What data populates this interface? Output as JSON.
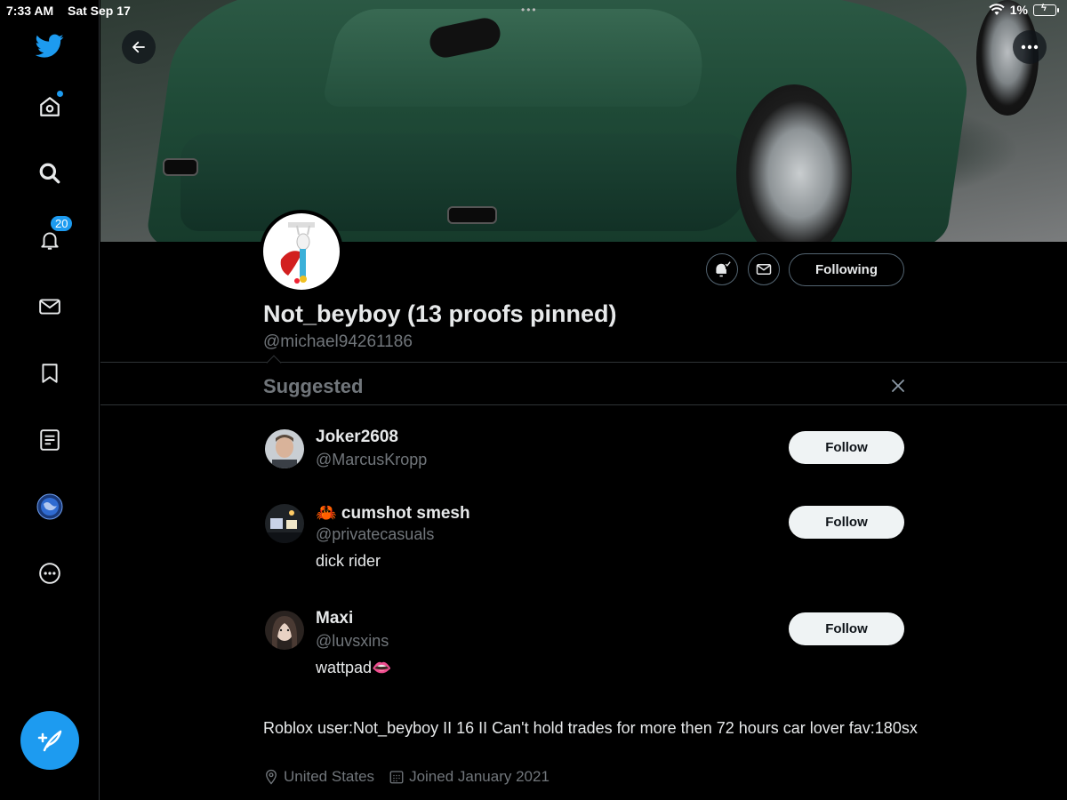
{
  "status_bar": {
    "time": "7:33 AM",
    "date": "Sat Sep 17",
    "battery": "1%"
  },
  "sidebar": {
    "items": [
      {
        "name": "twitter-logo"
      },
      {
        "name": "home"
      },
      {
        "name": "explore"
      },
      {
        "name": "notifications",
        "badge": "20"
      },
      {
        "name": "messages"
      },
      {
        "name": "bookmarks"
      },
      {
        "name": "lists"
      },
      {
        "name": "profile"
      },
      {
        "name": "more"
      }
    ],
    "compose_label": "Tweet"
  },
  "profile": {
    "display_name": "Not_beyboy (13 proofs pinned)",
    "handle": "@michael94261186",
    "following_label": "Following",
    "bio": "Roblox user:Not_beyboy II 16 II Can't hold trades for more then 72 hours car lover fav:180sx",
    "location": "United States",
    "joined": "Joined January 2021"
  },
  "suggested": {
    "title": "Suggested",
    "accounts": [
      {
        "name": "Joker2608",
        "handle": "@MarcusKropp",
        "bio": "",
        "follow_label": "Follow"
      },
      {
        "name": "🦀 cumshot smesh",
        "handle": "@privatecasuals",
        "bio": "dick rider",
        "follow_label": "Follow"
      },
      {
        "name": "Maxi",
        "handle": "@luvsxins",
        "bio": "wattpad👄",
        "follow_label": "Follow"
      }
    ]
  },
  "colors": {
    "accent": "#1d9bf0",
    "background": "#000000",
    "muted": "#71767b",
    "divider": "#2f3336"
  }
}
